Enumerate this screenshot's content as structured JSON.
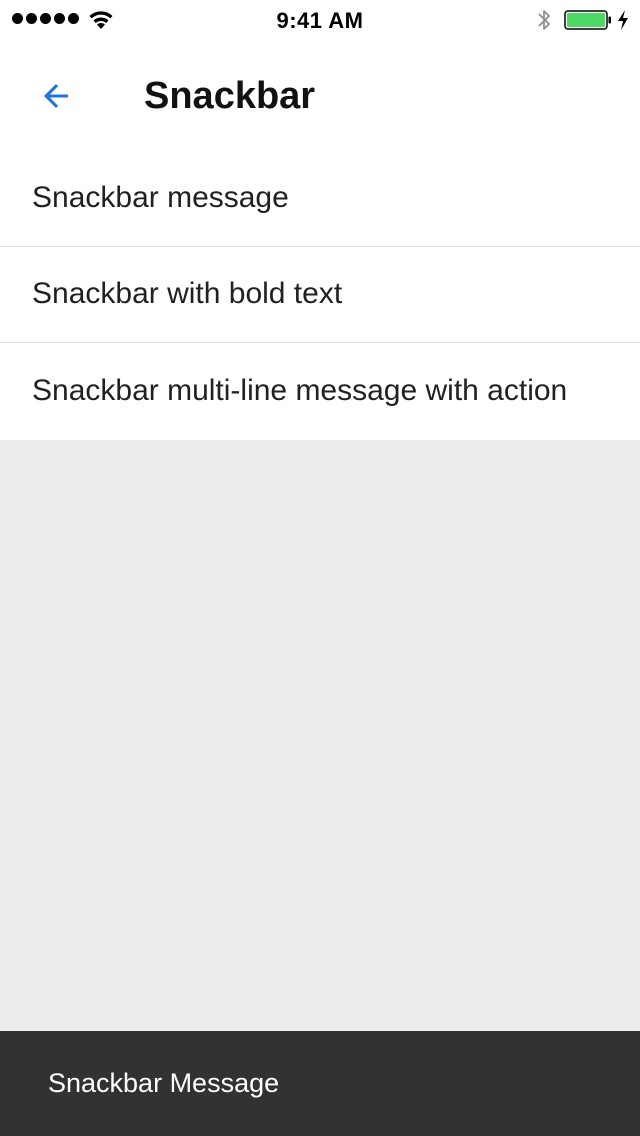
{
  "status_bar": {
    "time": "9:41 AM",
    "signal_icon": "signal-dots-icon",
    "wifi_icon": "wifi-icon",
    "bluetooth_icon": "bluetooth-icon",
    "battery_icon": "battery-icon",
    "charging_icon": "charging-bolt-icon",
    "battery_level": 1.0
  },
  "app_bar": {
    "back_icon": "arrow-back-icon",
    "title": "Snackbar"
  },
  "list": {
    "items": [
      {
        "label": "Snackbar message"
      },
      {
        "label": "Snackbar with bold text"
      },
      {
        "label": "Snackbar multi-line message with action"
      }
    ]
  },
  "snackbar": {
    "message": "Snackbar Message"
  },
  "colors": {
    "accent": "#1a73e8",
    "background": "#ececec",
    "surface": "#ffffff",
    "snackbar_bg": "#323232",
    "battery_fill": "#4cd964"
  }
}
